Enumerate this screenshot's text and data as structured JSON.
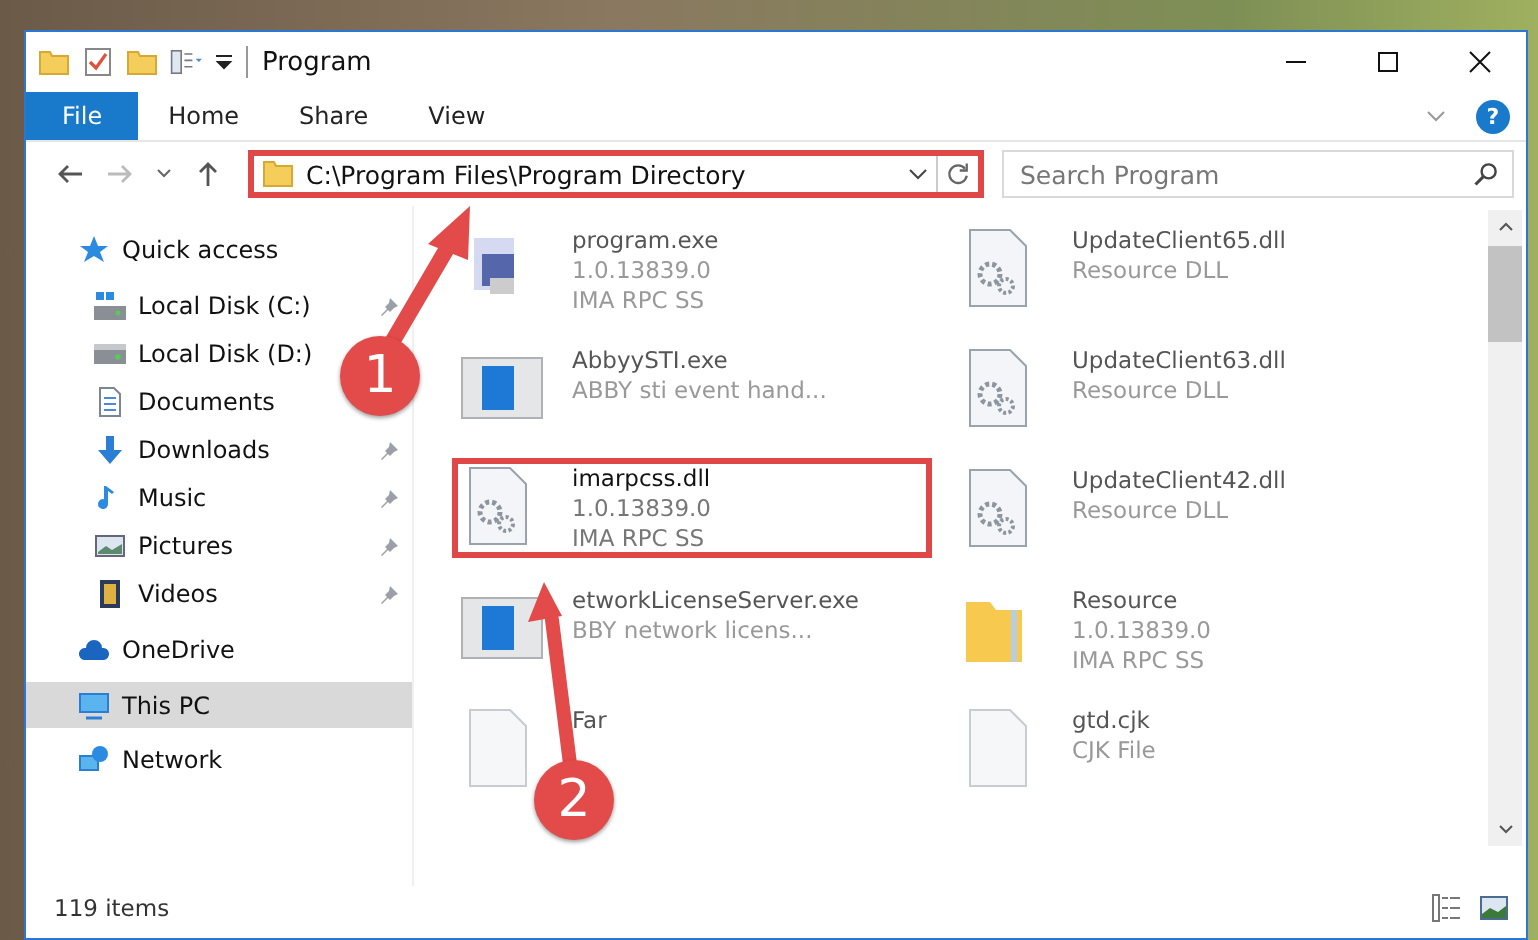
{
  "window": {
    "title": "Program"
  },
  "ribbon": {
    "tabs": [
      {
        "label": "File",
        "selected": true
      },
      {
        "label": "Home",
        "selected": false
      },
      {
        "label": "Share",
        "selected": false
      },
      {
        "label": "View",
        "selected": false
      }
    ],
    "help": "?"
  },
  "address_bar": {
    "path": "C:\\Program Files\\Program Directory",
    "highlighted": true
  },
  "search": {
    "placeholder": "Search Program"
  },
  "sidebar": {
    "items": [
      {
        "label": "Quick access",
        "kind": "star",
        "selected": false,
        "pinned": false,
        "group": true
      },
      {
        "label": "Local Disk (C:)",
        "kind": "osdrive",
        "selected": false,
        "pinned": true,
        "group": false
      },
      {
        "label": "Local Disk (D:)",
        "kind": "drive",
        "selected": false,
        "pinned": false,
        "group": false
      },
      {
        "label": "Documents",
        "kind": "documents",
        "selected": false,
        "pinned": false,
        "group": false
      },
      {
        "label": "Downloads",
        "kind": "downloads",
        "selected": false,
        "pinned": true,
        "group": false
      },
      {
        "label": "Music",
        "kind": "music",
        "selected": false,
        "pinned": true,
        "group": false
      },
      {
        "label": "Pictures",
        "kind": "pictures",
        "selected": false,
        "pinned": true,
        "group": false
      },
      {
        "label": "Videos",
        "kind": "videos",
        "selected": false,
        "pinned": true,
        "group": false
      },
      {
        "label": "OneDrive",
        "kind": "cloud",
        "selected": false,
        "pinned": false,
        "group": true
      },
      {
        "label": "This PC",
        "kind": "pc",
        "selected": true,
        "pinned": false,
        "group": true
      },
      {
        "label": "Network",
        "kind": "network",
        "selected": false,
        "pinned": false,
        "group": true
      }
    ]
  },
  "files": [
    {
      "name": "program.exe",
      "lines": [
        "1.0.13839.0",
        "IMA RPC SS"
      ],
      "kind": "exe",
      "highlighted": false
    },
    {
      "name": "UpdateClient65.dll",
      "lines": [
        "Resource DLL"
      ],
      "kind": "dll",
      "highlighted": false
    },
    {
      "name": "AbbyySTI.exe",
      "lines": [
        "ABBY sti event hand..."
      ],
      "kind": "app",
      "highlighted": false
    },
    {
      "name": "UpdateClient63.dll",
      "lines": [
        "Resource DLL"
      ],
      "kind": "dll",
      "highlighted": false
    },
    {
      "name": "imarpcss.dll",
      "lines": [
        "1.0.13839.0",
        "IMA RPC SS"
      ],
      "kind": "dll",
      "highlighted": true
    },
    {
      "name": "UpdateClient42.dll",
      "lines": [
        "Resource DLL"
      ],
      "kind": "dll",
      "highlighted": false
    },
    {
      "name": "etworkLicenseServer.exe",
      "lines": [
        "BBY network licens..."
      ],
      "kind": "app",
      "highlighted": false
    },
    {
      "name": "Resource",
      "lines": [
        "1.0.13839.0",
        "IMA RPC SS"
      ],
      "kind": "folder",
      "highlighted": false
    },
    {
      "name": "Far",
      "kind": "blank",
      "highlighted": false
    },
    {
      "name": "gtd.cjk",
      "lines": [
        "CJK File"
      ],
      "kind": "blank",
      "highlighted": false
    }
  ],
  "status_bar": {
    "count": "119 items"
  },
  "callouts": [
    {
      "number": "1"
    },
    {
      "number": "2"
    }
  ]
}
